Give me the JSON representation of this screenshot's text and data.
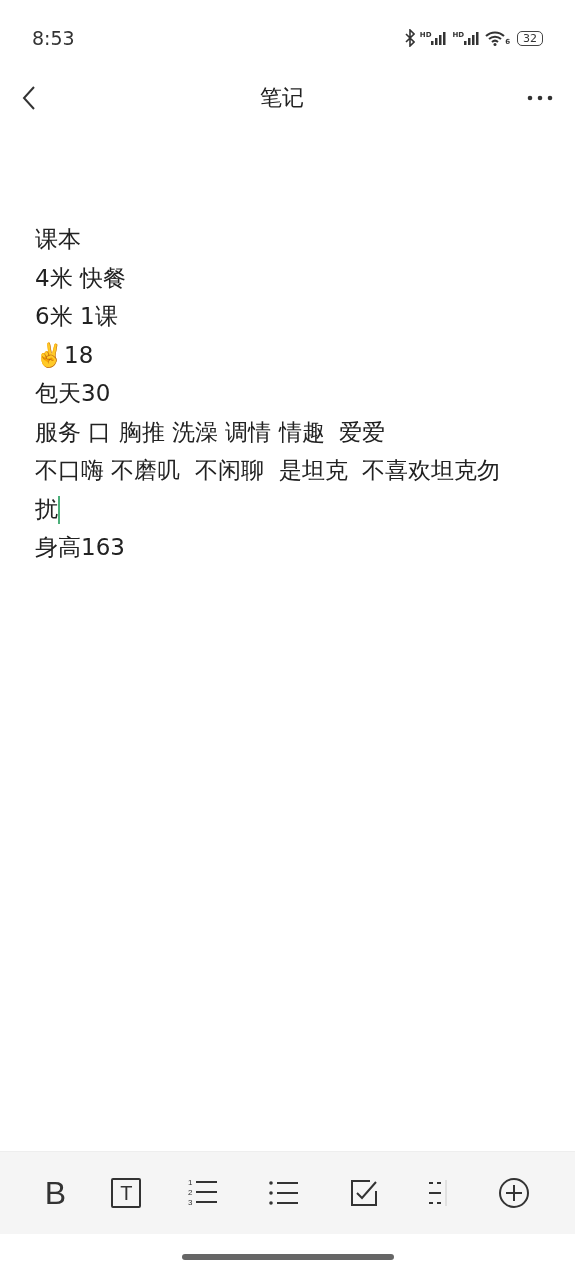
{
  "status_bar": {
    "time": "8:53",
    "signal_labels": [
      "HD",
      "HD"
    ],
    "wifi_label": "6",
    "battery": "32"
  },
  "nav": {
    "title": "笔记"
  },
  "note": {
    "lines": [
      {
        "text": "课本",
        "cursor": false
      },
      {
        "text": "4米 快餐",
        "cursor": false
      },
      {
        "text": "6米 1课",
        "cursor": false
      },
      {
        "text": "✌️18",
        "cursor": false
      },
      {
        "text": "包天30",
        "cursor": false
      },
      {
        "text": "服务 口 胸推 洗澡 调情 情趣  爱爱",
        "cursor": false
      },
      {
        "text": "不口嗨 不磨叽  不闲聊  是坦克  不喜欢坦克勿",
        "cursor": false
      },
      {
        "text": "扰",
        "cursor": true
      },
      {
        "text": "身高163",
        "cursor": false
      }
    ]
  },
  "toolbar": [
    {
      "kind": "bold",
      "label": "B"
    },
    {
      "kind": "boxed",
      "label": "T"
    },
    {
      "kind": "numbered",
      "numbers": [
        "1",
        "2",
        "3"
      ]
    },
    {
      "kind": "bullets"
    },
    {
      "kind": "checkbox"
    },
    {
      "kind": "divider"
    },
    {
      "kind": "add"
    }
  ]
}
